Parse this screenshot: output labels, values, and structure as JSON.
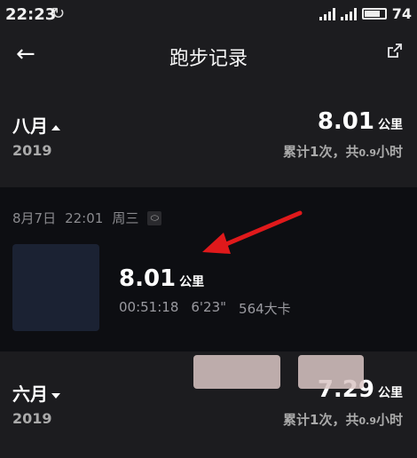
{
  "status_bar": {
    "time": "22:23",
    "battery": "74"
  },
  "header": {
    "title": "跑步记录"
  },
  "months": [
    {
      "name": "八月",
      "year": "2019",
      "distance": "8.01",
      "unit": "公里",
      "stats_prefix": "累计1次，共",
      "stats_small": "0.9",
      "stats_suffix": "小时"
    },
    {
      "name": "六月",
      "year": "2019",
      "distance": "7.29",
      "unit": "公里",
      "stats_prefix": "累计1次，共",
      "stats_small": "0.9",
      "stats_suffix": "小时"
    }
  ],
  "run": {
    "date": "8月7日",
    "time": "22:01",
    "weekday": "周三",
    "distance": "8.01",
    "unit": "公里",
    "duration": "00:51:18",
    "pace": "6'23\"",
    "calories": "564大卡"
  },
  "colors": {
    "background": "#1c1c1f",
    "run_card": "#0d0e12",
    "arrow": "#e0191b"
  }
}
